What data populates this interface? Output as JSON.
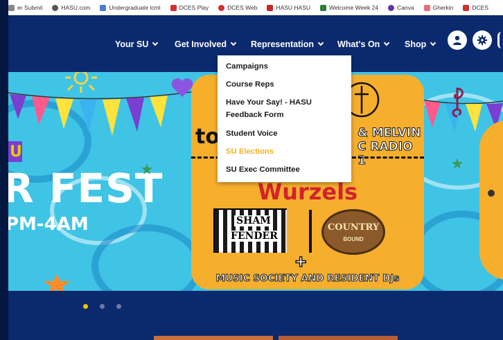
{
  "bookmarks": [
    {
      "label": "er Submit",
      "color": "#888888"
    },
    {
      "label": "HASU.com",
      "color": "#555555"
    },
    {
      "label": "Undergraduate lcml",
      "color": "#4a7bd0"
    },
    {
      "label": "DCES Play",
      "color": "#d32f2f"
    },
    {
      "label": "DCES Web",
      "color": "#d32f2f"
    },
    {
      "label": "HASU HASU",
      "color": "#c62828"
    },
    {
      "label": "Welcome Week 24",
      "color": "#2e7d32"
    },
    {
      "label": "Canva",
      "color": "#5e35b1"
    },
    {
      "label": "Gherkin",
      "color": "#e57373"
    },
    {
      "label": "DCES",
      "color": "#d32f2f"
    }
  ],
  "nav": {
    "items": [
      {
        "label": "Your SU"
      },
      {
        "label": "Get Involved"
      },
      {
        "label": "Representation"
      },
      {
        "label": "What's On"
      },
      {
        "label": "Shop"
      }
    ],
    "account_icon": "user-icon",
    "settings_icon": "gear-icon"
  },
  "dropdown": {
    "items": [
      {
        "label": "Campaigns",
        "active": false
      },
      {
        "label": "Course Reps",
        "active": false
      },
      {
        "label": "Have Your Say! - HASU",
        "label2": "Feedback Form",
        "active": false
      },
      {
        "label": "Student Voice",
        "active": false
      },
      {
        "label": "SU Elections",
        "active": true
      },
      {
        "label": "SU Exec Committee",
        "active": false
      }
    ]
  },
  "hero": {
    "left_text_1": "R FEST",
    "left_text_2": "PM-4AM",
    "left_badge": "U",
    "poster_top_left": "to",
    "poster_top_right_1": "& MELVIN",
    "poster_top_right_2": "C RADIO 1",
    "poster_headline": "Wurzels",
    "logo_left_1": "SHAM",
    "logo_left_2": "FENDER",
    "logo_right_1": "COUNTRY",
    "logo_right_2": "BOUND",
    "plus": "+",
    "poster_footer": "MUSIC SOCIETY AND RESIDENT DJs"
  },
  "carousel": {
    "active_index": 0,
    "count": 3,
    "active_color": "#f6c400",
    "inactive_color": "#6b7aa6"
  },
  "colors": {
    "nav_bg": "#0b2a6e",
    "hero_bg": "#3fc4e6",
    "poster_bg": "#f6ae2d",
    "accent_active": "#f3b21a"
  }
}
